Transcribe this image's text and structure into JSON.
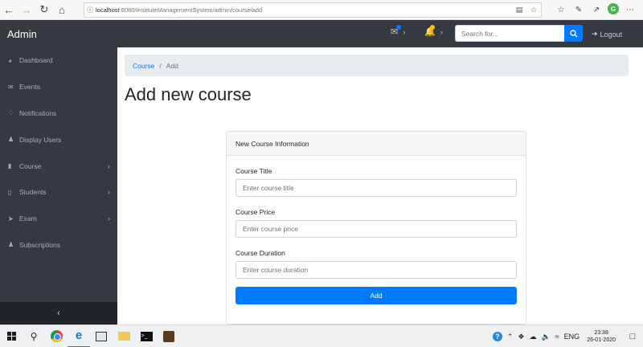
{
  "browser": {
    "url_host": "localhost",
    "url_rest": ":8080/InstituteManagementSystem/admin/course/add",
    "icons": [
      "back-icon",
      "forward-icon",
      "reload-icon",
      "home-icon",
      "info-icon",
      "reader-mode-icon",
      "favorite-icon",
      "favorites-bar-icon",
      "pen-icon",
      "share-icon",
      "profile-icon",
      "more-icon"
    ],
    "profile_letter": "G"
  },
  "navbar": {
    "brand": "Admin",
    "search_placeholder": "Search for...",
    "logout_label": "Logout",
    "alert_colors": {
      "messages": "#007bff",
      "notifications": "#ffc107"
    }
  },
  "sidebar": {
    "items": [
      {
        "label": "Dashboard",
        "icon": "tachometer-icon",
        "has_children": false
      },
      {
        "label": "Events",
        "icon": "envelope-icon",
        "has_children": false
      },
      {
        "label": "Notifications",
        "icon": "bell-icon",
        "has_children": false
      },
      {
        "label": "Display Users",
        "icon": "user-icon",
        "has_children": false
      },
      {
        "label": "Course",
        "icon": "book-icon",
        "has_children": true
      },
      {
        "label": "Students",
        "icon": "file-icon",
        "has_children": true
      },
      {
        "label": "Exam",
        "icon": "paper-plane-icon",
        "has_children": true
      },
      {
        "label": "Subscriptions",
        "icon": "user-icon",
        "has_children": false
      }
    ],
    "toggle_icon": "chevron-left-icon"
  },
  "breadcrumb": {
    "parent": "Course",
    "separator": "/",
    "current": "Add"
  },
  "page_title": "Add new course",
  "form": {
    "header": "New Course Information",
    "fields": [
      {
        "label": "Course Title",
        "placeholder": "Enter course title"
      },
      {
        "label": "Course Price",
        "placeholder": "Enter course price"
      },
      {
        "label": "Course Duration",
        "placeholder": "Enter course duration"
      }
    ],
    "submit_label": "Add"
  },
  "taskbar": {
    "language": "ENG",
    "time": "23:38",
    "date": "26-01-2020"
  },
  "colors": {
    "navbar_bg": "#343a40",
    "primary": "#007bff",
    "breadcrumb_bg": "#e9ecef"
  }
}
